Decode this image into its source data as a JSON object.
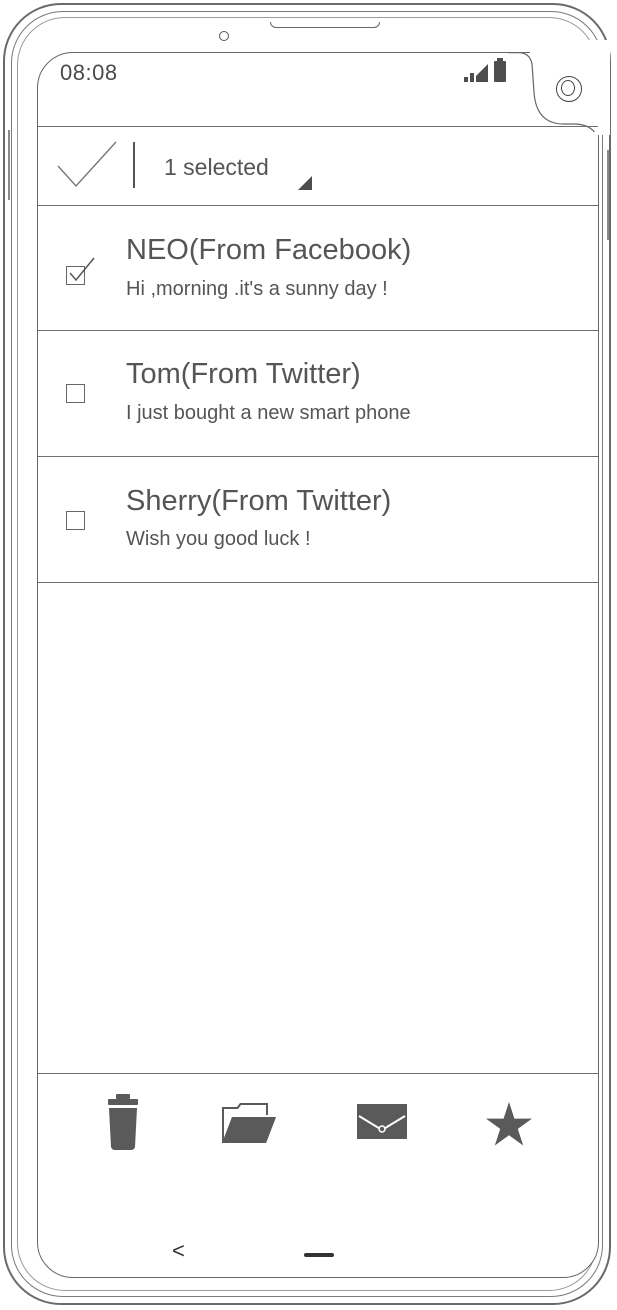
{
  "status_bar": {
    "time": "08:08"
  },
  "action_bar": {
    "selected_label": "1 selected"
  },
  "messages": [
    {
      "name": "NEO(From Facebook)",
      "message": "Hi ,morning .it's a sunny day !",
      "checked": true
    },
    {
      "name": "Tom(From Twitter)",
      "message": "I just bought a new smart phone",
      "checked": false
    },
    {
      "name": "Sherry(From Twitter)",
      "message": "Wish you good luck !",
      "checked": false
    }
  ],
  "toolbar": {
    "icons": [
      "trash-icon",
      "folder-icon",
      "mail-icon",
      "star-icon"
    ]
  },
  "nav_bar": {
    "back_glyph": "<"
  },
  "colors": {
    "icon_fill": "#5a5a5a",
    "line": "#6e6e6e"
  }
}
